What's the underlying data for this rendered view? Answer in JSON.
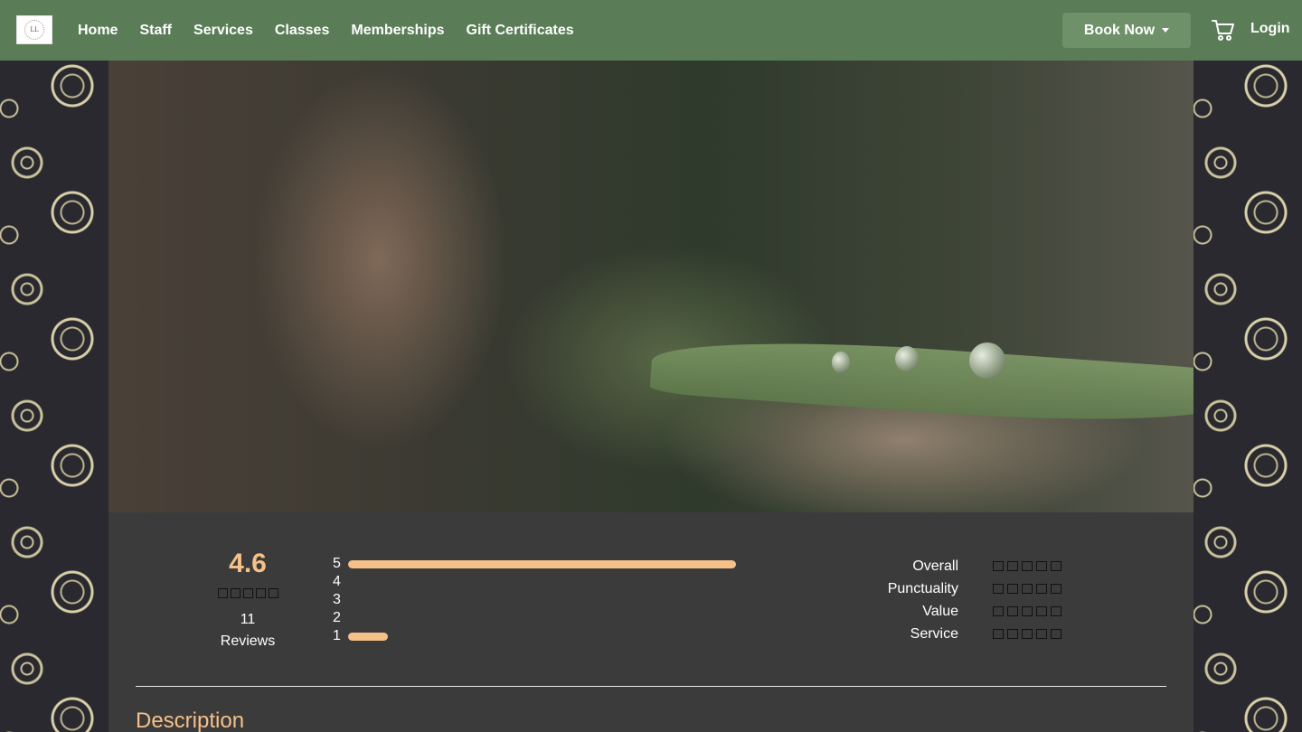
{
  "nav": {
    "logo_text": "LL",
    "links": [
      "Home",
      "Staff",
      "Services",
      "Classes",
      "Memberships",
      "Gift Certificates"
    ],
    "book_now": "Book Now",
    "login": "Login"
  },
  "reviews": {
    "average": "4.6",
    "average_stars": 5,
    "count": "11",
    "count_label": "Reviews",
    "distribution": [
      {
        "stars": "5",
        "fraction": 1.0
      },
      {
        "stars": "4",
        "fraction": 0
      },
      {
        "stars": "3",
        "fraction": 0
      },
      {
        "stars": "2",
        "fraction": 0
      },
      {
        "stars": "1",
        "fraction": 0.1
      }
    ],
    "categories": [
      {
        "label": "Overall",
        "stars": 5
      },
      {
        "label": "Punctuality",
        "stars": 5
      },
      {
        "label": "Value",
        "stars": 5
      },
      {
        "label": "Service",
        "stars": 5
      }
    ]
  },
  "description_heading": "Description",
  "colors": {
    "nav_bg": "#5a7d57",
    "accent": "#f6c089",
    "panel_bg": "#3b3b3b"
  }
}
